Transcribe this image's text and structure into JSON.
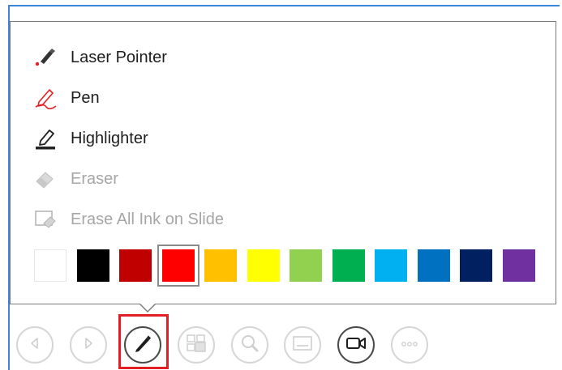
{
  "pen_menu": {
    "items": [
      {
        "label": "Laser Pointer",
        "icon": "laser-pointer-icon",
        "enabled": true
      },
      {
        "label": "Pen",
        "icon": "pen-icon",
        "enabled": true
      },
      {
        "label": "Highlighter",
        "icon": "highlighter-icon",
        "enabled": true
      },
      {
        "label": "Eraser",
        "icon": "eraser-icon",
        "enabled": false
      },
      {
        "label": "Erase All Ink on Slide",
        "icon": "erase-all-ink-icon",
        "enabled": false
      }
    ],
    "colors": [
      "#ffffff",
      "#000000",
      "#c00000",
      "#ff0000",
      "#ffc000",
      "#ffff00",
      "#92d050",
      "#00b050",
      "#00b0f0",
      "#0070c0",
      "#002060",
      "#7030a0"
    ],
    "selected_color": "#ff0000"
  },
  "toolbar": {
    "buttons": [
      {
        "name": "previous",
        "icon": "triangle-left-icon",
        "enabled": false
      },
      {
        "name": "next",
        "icon": "triangle-right-icon",
        "enabled": false
      },
      {
        "name": "pen-tools",
        "icon": "pen-icon",
        "enabled": true,
        "active": true
      },
      {
        "name": "see-all-slides",
        "icon": "slides-grid-icon",
        "enabled": false
      },
      {
        "name": "zoom",
        "icon": "magnifier-icon",
        "enabled": false
      },
      {
        "name": "subtitles",
        "icon": "subtitles-icon",
        "enabled": false
      },
      {
        "name": "camera",
        "icon": "video-camera-icon",
        "enabled": true
      },
      {
        "name": "more-options",
        "icon": "ellipsis-icon",
        "enabled": false
      }
    ]
  }
}
